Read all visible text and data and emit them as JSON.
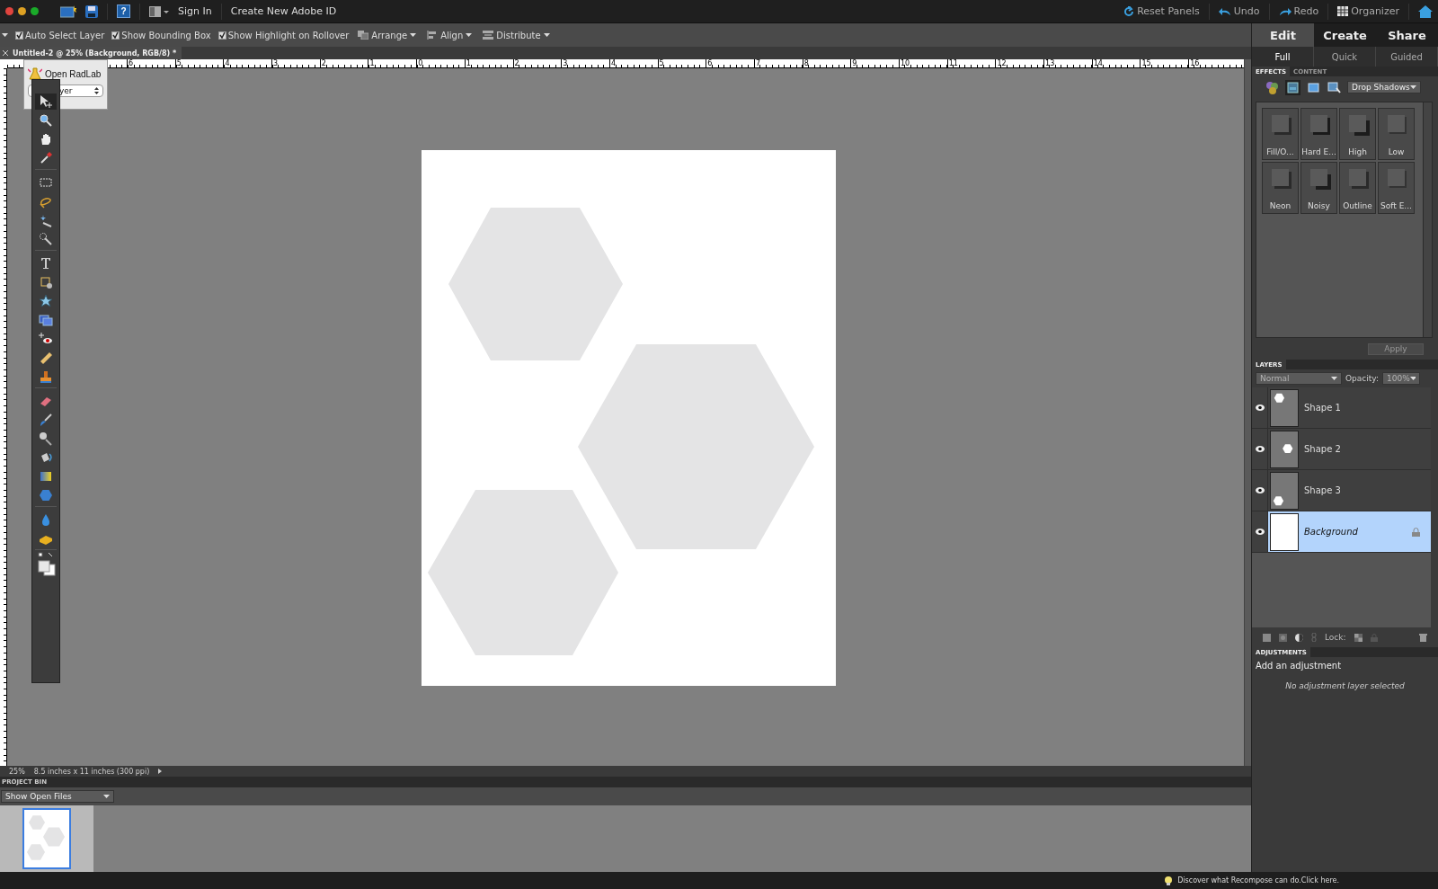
{
  "top_bar": {
    "help": "?",
    "sign_in": "Sign In",
    "create_id": "Create New Adobe ID",
    "right": [
      {
        "kind": "reset",
        "label": "Reset Panels"
      },
      {
        "kind": "undo",
        "label": "Undo"
      },
      {
        "kind": "redo",
        "label": "Redo"
      },
      {
        "kind": "organizer",
        "label": "Organizer"
      }
    ]
  },
  "options_bar": {
    "checkboxes": [
      {
        "label": "Auto Select Layer",
        "checked": true
      },
      {
        "label": "Show Bounding Box",
        "checked": true
      },
      {
        "label": "Show Highlight on Rollover",
        "checked": true
      }
    ],
    "menus": [
      {
        "kind": "arrange",
        "label": "Arrange"
      },
      {
        "kind": "align",
        "label": "Align"
      },
      {
        "kind": "distribute",
        "label": "Distribute"
      }
    ]
  },
  "document_tab": {
    "title": "Untitled-2 @ 25% (Background, RGB/8) *"
  },
  "ruler": {
    "labels": [
      "6",
      "5",
      "4",
      "3",
      "2",
      "1",
      "0",
      "1",
      "2",
      "3",
      "4",
      "5",
      "6",
      "7",
      "8",
      "9",
      "10",
      "11",
      "12",
      "13",
      "14",
      "15",
      "16"
    ]
  },
  "radlab_panel": {
    "label": "Open RadLab",
    "dropdown": "yer"
  },
  "toolbox": {
    "groups": [
      [
        {
          "kind": "move",
          "selected": true
        },
        {
          "kind": "zoom",
          "selected": false
        },
        {
          "kind": "hand",
          "selected": false
        },
        {
          "kind": "eyedropper",
          "selected": false
        }
      ],
      [
        {
          "kind": "marquee",
          "selected": false
        },
        {
          "kind": "lasso",
          "selected": false
        },
        {
          "kind": "wand",
          "selected": false
        },
        {
          "kind": "quickselect",
          "selected": false
        }
      ],
      [
        {
          "kind": "type",
          "selected": false
        },
        {
          "kind": "crop",
          "selected": false
        },
        {
          "kind": "cookie",
          "selected": false
        },
        {
          "kind": "recompose",
          "selected": false
        },
        {
          "kind": "redeye",
          "selected": false
        },
        {
          "kind": "heal",
          "selected": false
        },
        {
          "kind": "stamp",
          "selected": false
        }
      ],
      [
        {
          "kind": "eraser",
          "selected": false
        },
        {
          "kind": "brush",
          "selected": false
        },
        {
          "kind": "smartbrush",
          "selected": false
        },
        {
          "kind": "bucket",
          "selected": false
        },
        {
          "kind": "gradient",
          "selected": false
        },
        {
          "kind": "shape",
          "selected": false
        }
      ],
      [
        {
          "kind": "blur",
          "selected": false
        },
        {
          "kind": "sponge",
          "selected": false
        }
      ]
    ]
  },
  "status_bar": {
    "zoom": "25%",
    "size": "8.5 inches x 11 inches (300 ppi)"
  },
  "project_bin": {
    "title": "PROJECT BIN",
    "dropdown": "Show Open Files",
    "files": [
      {
        "selected": true
      }
    ]
  },
  "bottom_bar": {
    "tip": "Discover what Recompose can do.Click here."
  },
  "mode_tabs": [
    {
      "label": "Edit",
      "selected": true
    },
    {
      "label": "Create",
      "selected": false
    },
    {
      "label": "Share",
      "selected": false
    }
  ],
  "edit_tabs": [
    {
      "label": "Full",
      "selected": true
    },
    {
      "label": "Quick",
      "selected": false
    },
    {
      "label": "Guided",
      "selected": false
    }
  ],
  "effects_panel": {
    "tabs": [
      {
        "label": "EFFECTS",
        "selected": true
      },
      {
        "label": "CONTENT",
        "selected": false
      }
    ],
    "categories": [
      {
        "kind": "styles",
        "selected": false
      },
      {
        "kind": "layers",
        "selected": true
      },
      {
        "kind": "frame",
        "selected": false
      },
      {
        "kind": "fx",
        "selected": false
      }
    ],
    "dropdown": "Drop Shadows",
    "items": [
      {
        "label": "Fill/O...",
        "kind": "edge"
      },
      {
        "label": "Hard E...",
        "kind": "hard"
      },
      {
        "label": "High",
        "kind": "high"
      },
      {
        "label": "Low",
        "kind": "low"
      },
      {
        "label": "Neon",
        "kind": "edge"
      },
      {
        "label": "Noisy",
        "kind": "high"
      },
      {
        "label": "Outline",
        "kind": "edge"
      },
      {
        "label": "Soft E...",
        "kind": "low"
      }
    ],
    "apply": {
      "label": "Apply",
      "disabled": true
    }
  },
  "layers_panel": {
    "title": "LAYERS",
    "blend_mode": {
      "value": "Normal",
      "disabled": true
    },
    "opacity_label": "Opacity:",
    "opacity": {
      "value": "100%",
      "disabled": true
    },
    "layers": [
      {
        "name": "Shape 1",
        "kind": "top-left",
        "visible": true,
        "selected": false,
        "locked": false
      },
      {
        "name": "Shape 2",
        "kind": "middle-right",
        "visible": true,
        "selected": false,
        "locked": false
      },
      {
        "name": "Shape 3",
        "kind": "bottom-left",
        "visible": true,
        "selected": false,
        "locked": false
      },
      {
        "name": "Background",
        "kind": "white",
        "visible": true,
        "selected": true,
        "locked": true
      }
    ],
    "lock_label": "Lock:"
  },
  "adjustments_panel": {
    "title": "ADJUSTMENTS",
    "heading": "Add an adjustment",
    "message": "No adjustment layer selected"
  }
}
